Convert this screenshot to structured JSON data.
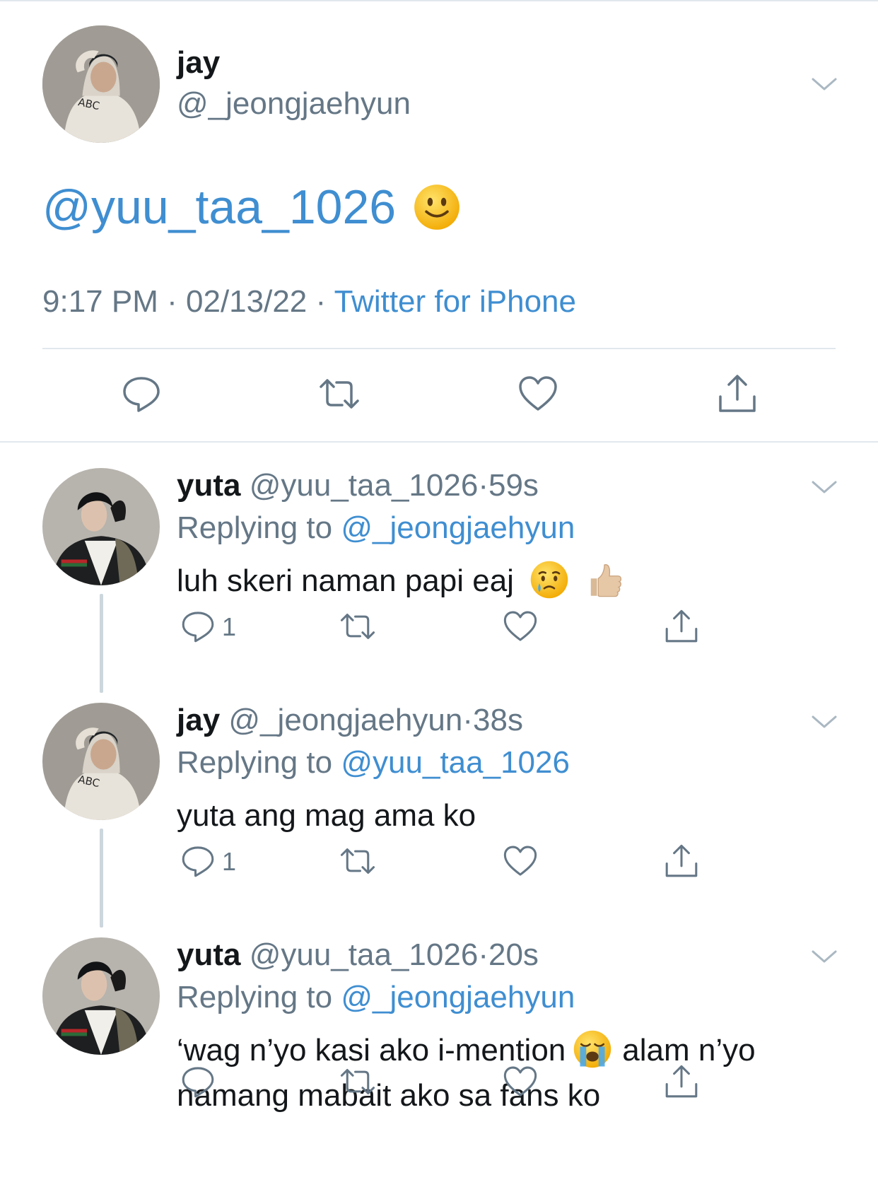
{
  "main_tweet": {
    "display_name": "jay",
    "handle": "@_jeongjaehyun",
    "text": "@yuu_taa_1026",
    "text_emoji": "slightly-smiling-face",
    "time": "9:17 PM",
    "date": "02/13/22",
    "source": "Twitter for iPhone",
    "separator": "·"
  },
  "replies": [
    {
      "display_name": "yuta",
      "handle": "@yuu_taa_1026",
      "age": "59s",
      "replying_prefix": "Replying to",
      "replying_to": "@_jeongjaehyun",
      "text": "luh skeri naman papi eaj",
      "text_after": "",
      "text_line2": "",
      "emojis": [
        "crying-face",
        "thumbs-up"
      ],
      "reply_count": "1"
    },
    {
      "display_name": "jay",
      "handle": "@_jeongjaehyun",
      "age": "38s",
      "replying_prefix": "Replying to",
      "replying_to": "@yuu_taa_1026",
      "text": "yuta ang mag ama ko",
      "text_after": "",
      "text_line2": "",
      "emojis": [],
      "reply_count": "1"
    },
    {
      "display_name": "yuta",
      "handle": "@yuu_taa_1026",
      "age": "20s",
      "replying_prefix": "Replying to",
      "replying_to": "@_jeongjaehyun",
      "text": "‘wag n’yo kasi ako i-mention",
      "text_after": "alam n’yo",
      "text_line2": "namang mabait ako sa fans ko",
      "emojis": [
        "loudly-crying-face"
      ],
      "reply_count": ""
    }
  ],
  "colors": {
    "link": "#3f8ed1",
    "secondary_text": "#657786",
    "primary_text": "#14171a",
    "divider": "#e1e8ed",
    "thread_line": "#ccd6dd"
  }
}
